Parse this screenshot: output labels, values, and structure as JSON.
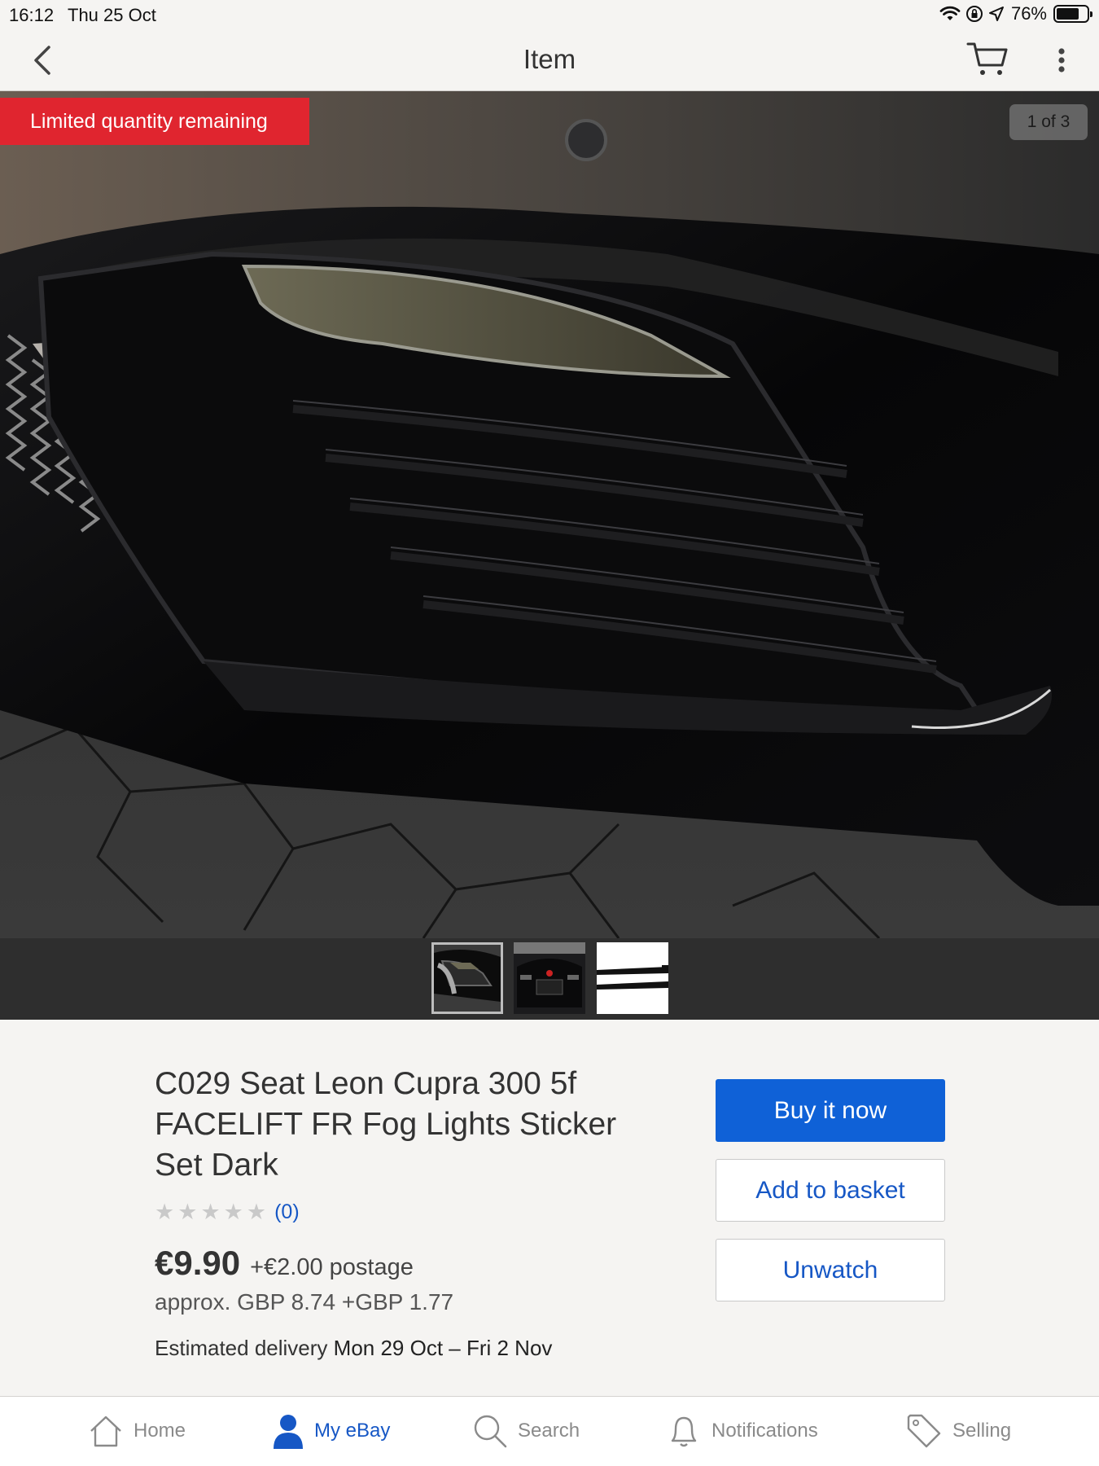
{
  "status_bar": {
    "time": "16:12",
    "date": "Thu 25 Oct",
    "battery_percent_label": "76%",
    "battery_level": 0.76
  },
  "nav": {
    "title": "Item",
    "icons": [
      "back-chevron-icon",
      "cart-icon",
      "more-vertical-icon"
    ]
  },
  "gallery": {
    "badge": "Limited quantity remaining",
    "counter": "1 of 3",
    "thumbnail_count": 3,
    "selected_index": 0
  },
  "item": {
    "title": "C029 Seat Leon Cupra 300 5f FACELIFT FR Fog Lights Sticker Set Dark",
    "rating_count": "(0)",
    "rating_stars": 0,
    "price": "€9.90",
    "postage": "+€2.00 postage",
    "approx": "approx. GBP 8.74 +GBP 1.77",
    "delivery_label": "Estimated delivery",
    "delivery_dates": "Mon 29 Oct – Fri 2 Nov"
  },
  "actions": {
    "buy_now": "Buy it now",
    "add_to_basket": "Add to basket",
    "unwatch": "Unwatch"
  },
  "tabbar": {
    "items": [
      {
        "label": "Home",
        "icon": "home-icon"
      },
      {
        "label": "My eBay",
        "icon": "person-icon"
      },
      {
        "label": "Search",
        "icon": "search-icon"
      },
      {
        "label": "Notifications",
        "icon": "bell-icon"
      },
      {
        "label": "Selling",
        "icon": "tag-icon"
      }
    ],
    "active_index": 1
  },
  "colors": {
    "brand_blue": "#0f61d7",
    "link_blue": "#1657c5",
    "alert_red": "#e0252f"
  }
}
